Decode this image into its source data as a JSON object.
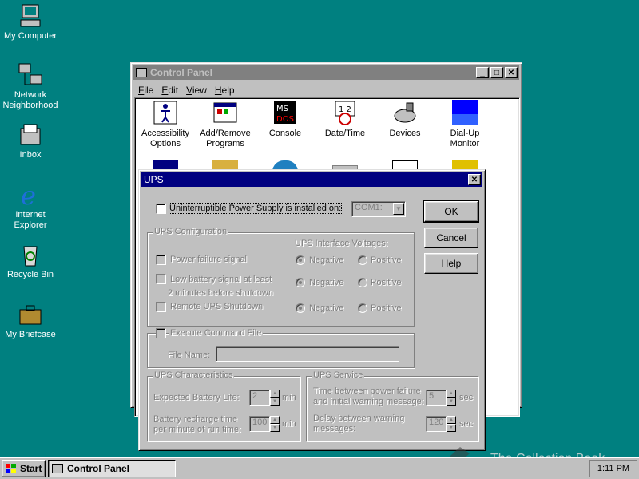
{
  "desktop": {
    "icons": [
      {
        "label": "My Computer",
        "icon": "my-computer-icon"
      },
      {
        "label": "Network Neighborhood",
        "icon": "network-icon"
      },
      {
        "label": "Inbox",
        "icon": "inbox-icon"
      },
      {
        "label": "Internet Explorer",
        "icon": "ie-icon"
      },
      {
        "label": "Recycle Bin",
        "icon": "recycle-bin-icon"
      },
      {
        "label": "My Briefcase",
        "icon": "briefcase-icon"
      }
    ]
  },
  "control_panel": {
    "title": "Control Panel",
    "menu": [
      "File",
      "Edit",
      "View",
      "Help"
    ],
    "items": [
      {
        "label": "Accessibility Options"
      },
      {
        "label": "Add/Remove Programs"
      },
      {
        "label": "Console"
      },
      {
        "label": "Date/Time"
      },
      {
        "label": "Devices"
      },
      {
        "label": "Dial-Up Monitor"
      }
    ]
  },
  "ups_dialog": {
    "title": "UPS",
    "installed_label": "Uninterruptible Power Supply is installed on:",
    "port_value": "COM1:",
    "ok": "OK",
    "cancel": "Cancel",
    "help": "Help",
    "config_group": "UPS Configuration",
    "voltages_label": "UPS Interface Voltages:",
    "power_failure": "Power failure signal",
    "low_battery": "Low battery signal at least",
    "low_battery_2": "2 minutes before shutdown",
    "remote_shutdown": "Remote UPS Shutdown",
    "negative": "Negative",
    "positive": "Positive",
    "execute_cmd": "Execute Command File",
    "file_name_label": "File Name:",
    "characteristics_group": "UPS Characteristics",
    "battery_life_label": "Expected  Battery Life:",
    "battery_life_value": "2",
    "min": "min",
    "recharge_label_1": "Battery recharge time",
    "recharge_label_2": "per minute of run time:",
    "recharge_value": "100",
    "service_group": "UPS Service",
    "time_between_1": "Time between power failure",
    "time_between_2": "and initial warning message:",
    "time_between_value": "5",
    "delay_1": "Delay between warning",
    "delay_2": "messages:",
    "delay_value": "120",
    "sec": "sec"
  },
  "taskbar": {
    "start": "Start",
    "task": "Control Panel",
    "clock": "1:11 PM"
  },
  "watermark": "The Collection Book"
}
